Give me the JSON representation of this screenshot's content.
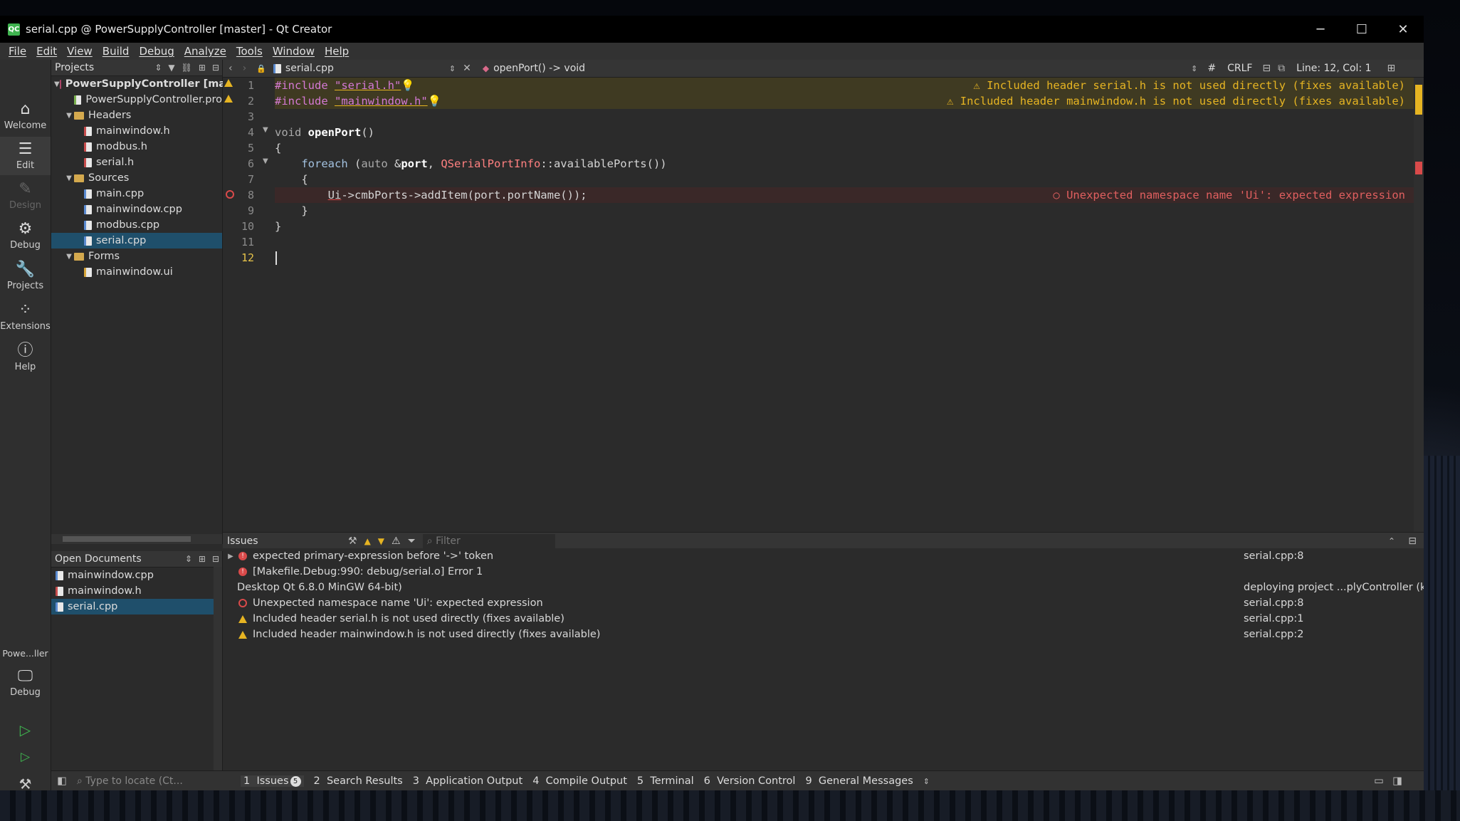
{
  "window": {
    "title": "serial.cpp @ PowerSupplyController [master] - Qt Creator",
    "logo": "QC"
  },
  "menu": [
    "File",
    "Edit",
    "View",
    "Build",
    "Debug",
    "Analyze",
    "Tools",
    "Window",
    "Help"
  ],
  "modes": [
    {
      "label": "Welcome",
      "icon": "home-icon"
    },
    {
      "label": "Edit",
      "icon": "edit-icon"
    },
    {
      "label": "Design",
      "icon": "design-icon"
    },
    {
      "label": "Debug",
      "icon": "debug-icon"
    },
    {
      "label": "Projects",
      "icon": "wrench-icon"
    },
    {
      "label": "Extensions",
      "icon": "extensions-icon"
    },
    {
      "label": "Help",
      "icon": "help-icon"
    }
  ],
  "kit": {
    "project": "Powe...ller",
    "mode": "Debug"
  },
  "projects_panel": {
    "title": "Projects",
    "tree": [
      {
        "label": "PowerSupplyController [mas",
        "kind": "project",
        "level": 0,
        "arrow": "▼"
      },
      {
        "label": "PowerSupplyController.pro",
        "kind": "pro",
        "level": 1,
        "arrow": ""
      },
      {
        "label": "Headers",
        "kind": "folder",
        "level": 1,
        "arrow": "▼"
      },
      {
        "label": "mainwindow.h",
        "kind": "h",
        "level": 2,
        "arrow": ""
      },
      {
        "label": "modbus.h",
        "kind": "h",
        "level": 2,
        "arrow": ""
      },
      {
        "label": "serial.h",
        "kind": "h",
        "level": 2,
        "arrow": ""
      },
      {
        "label": "Sources",
        "kind": "folder",
        "level": 1,
        "arrow": "▼"
      },
      {
        "label": "main.cpp",
        "kind": "cpp",
        "level": 2,
        "arrow": ""
      },
      {
        "label": "mainwindow.cpp",
        "kind": "cpp",
        "level": 2,
        "arrow": ""
      },
      {
        "label": "modbus.cpp",
        "kind": "cpp",
        "level": 2,
        "arrow": ""
      },
      {
        "label": "serial.cpp",
        "kind": "cpp",
        "level": 2,
        "arrow": "",
        "selected": true
      },
      {
        "label": "Forms",
        "kind": "folder",
        "level": 1,
        "arrow": "▼"
      },
      {
        "label": "mainwindow.ui",
        "kind": "ui",
        "level": 2,
        "arrow": ""
      }
    ]
  },
  "open_documents": {
    "title": "Open Documents",
    "items": [
      {
        "label": "mainwindow.cpp",
        "kind": "cpp"
      },
      {
        "label": "mainwindow.h",
        "kind": "h"
      },
      {
        "label": "serial.cpp",
        "kind": "cpp",
        "selected": true
      }
    ]
  },
  "editor": {
    "file": "serial.cpp",
    "symbol": "openPort() -> void",
    "hash": "#",
    "line_ending": "CRLF",
    "position": "Line: 12, Col: 1",
    "annotations": {
      "line1": "Included header serial.h is not used directly (fixes available)",
      "line2": "Included header mainwindow.h is not used directly (fixes available)",
      "line8": "Unexpected namespace name 'Ui': expected expression"
    },
    "line_numbers": [
      "1",
      "2",
      "3",
      "4",
      "5",
      "6",
      "7",
      "8",
      "9",
      "10",
      "11",
      "12"
    ]
  },
  "issues_panel": {
    "title": "Issues",
    "filter_placeholder": "Filter",
    "rows": [
      {
        "type": "error",
        "text": "expected primary-expression before '->' token",
        "loc": "serial.cpp:8",
        "expand": "▶"
      },
      {
        "type": "error",
        "text": "[Makefile.Debug:990: debug/serial.o] Error 1",
        "loc": ""
      },
      {
        "type": "none",
        "text": "Desktop Qt 6.8.0 MinGW 64-bit)",
        "loc": "deploying project ...plyController (kit"
      },
      {
        "type": "error-hollow",
        "text": "Unexpected namespace name 'Ui': expected expression",
        "loc": "serial.cpp:8"
      },
      {
        "type": "warning",
        "text": "Included header serial.h is not used directly (fixes available)",
        "loc": "serial.cpp:1"
      },
      {
        "type": "warning",
        "text": "Included header mainwindow.h is not used directly (fixes available)",
        "loc": "serial.cpp:2"
      }
    ]
  },
  "bottom": {
    "locator_placeholder": "Type to locate (Ct...",
    "tabs": [
      {
        "label": "1  Issues",
        "badge": "5",
        "active": true
      },
      {
        "label": "2  Search Results"
      },
      {
        "label": "3  Application Output"
      },
      {
        "label": "4  Compile Output"
      },
      {
        "label": "5  Terminal"
      },
      {
        "label": "6  Version Control"
      },
      {
        "label": "9  General Messages"
      }
    ]
  }
}
